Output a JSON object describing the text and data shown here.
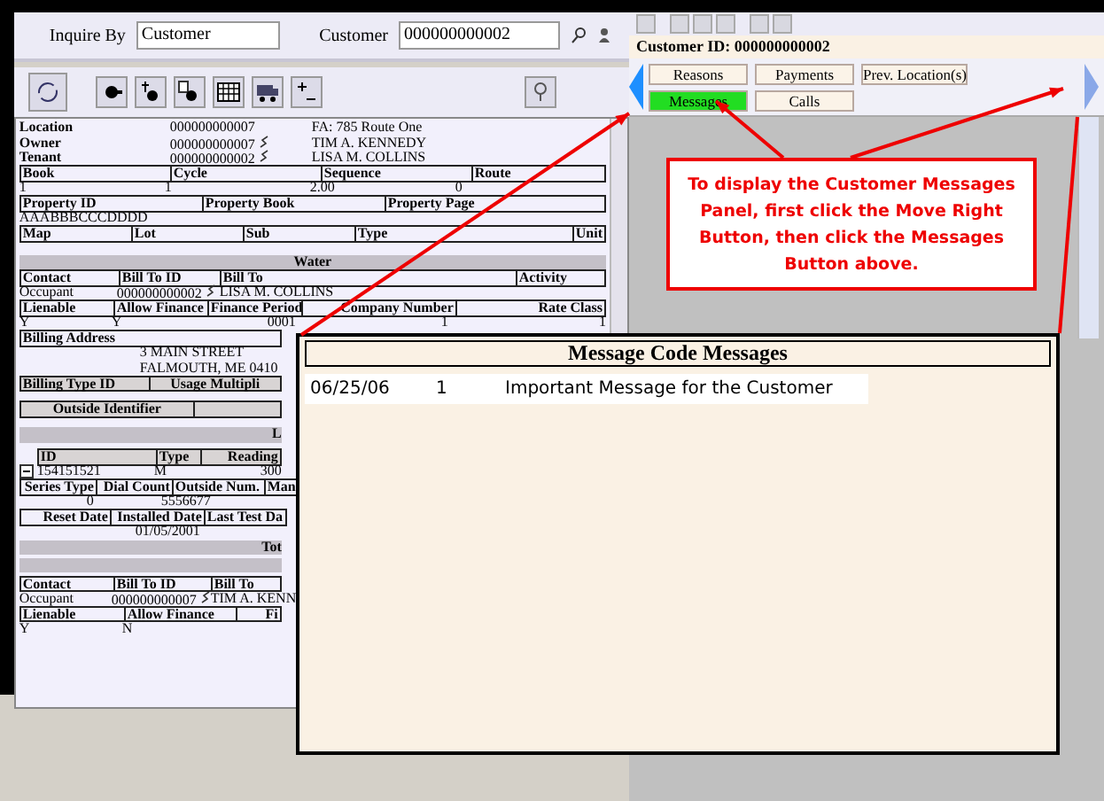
{
  "inquiry": {
    "inquire_by_label": "Inquire By",
    "inquire_by": "Customer",
    "customer_label": "Customer",
    "customer": "000000000002"
  },
  "parties": [
    {
      "label": "Location",
      "id": "000000000007",
      "linked": false,
      "name": "FA: 785 Route One"
    },
    {
      "label": "Owner",
      "id": "000000000007",
      "linked": true,
      "name": "TIM A. KENNEDY"
    },
    {
      "label": "Tenant",
      "id": "000000000002",
      "linked": true,
      "name": "LISA M. COLLINS"
    }
  ],
  "route_grid": {
    "headers": [
      "Book",
      "Cycle",
      "Sequence",
      "Route"
    ],
    "values": [
      "1",
      "1",
      "2.00",
      "0"
    ]
  },
  "property_grid": {
    "headers": [
      "Property ID",
      "Property Book",
      "Property Page"
    ],
    "values": [
      "AAABBBCCCDDDD"
    ]
  },
  "map_grid": {
    "headers": [
      "Map",
      "Lot",
      "Sub",
      "Type",
      "Unit"
    ]
  },
  "water": {
    "title": "Water",
    "contact_headers": [
      "Contact",
      "Bill To ID",
      "Bill To",
      "Activity"
    ],
    "contact_row": {
      "contact": "Occupant",
      "id": "000000000002",
      "linked": true,
      "name": "LISA M. COLLINS"
    },
    "lien_headers": [
      "Lienable",
      "Allow Finance",
      "Finance Period",
      "Company Number",
      "Rate Class"
    ],
    "lien_values": [
      "Y",
      "Y",
      "0001",
      "1",
      "1"
    ],
    "billing_address_label": "Billing Address",
    "address_lines": [
      "3 MAIN STREET",
      "FALMOUTH, ME 0410"
    ],
    "billing_type_label": "Billing Type ID",
    "usage_label": "Usage Multipli",
    "outside_identifier_label": "Outside Identifier",
    "section_heading": "L",
    "meter": {
      "headers": [
        "ID",
        "Type",
        "Reading"
      ],
      "expanded": true,
      "values": [
        "154151521",
        "M",
        "300"
      ]
    },
    "series_headers": [
      "Series Type",
      "Dial Count",
      "Outside Num.",
      "Man"
    ],
    "series_values": [
      "0",
      "5",
      "556677"
    ],
    "date_headers": [
      "Reset Date",
      "Installed Date",
      "Last Test Da"
    ],
    "date_values": [
      "01/05/2001"
    ],
    "total_heading": "Tot"
  },
  "second_contact": {
    "headers": [
      "Contact",
      "Bill To ID",
      "Bill To"
    ],
    "row": {
      "contact": "Occupant",
      "id": "000000000007",
      "linked": true,
      "name": "TIM A. KENN"
    },
    "lien_headers": [
      "Lienable",
      "Allow Finance",
      "Fi"
    ],
    "lien_values": [
      "Y",
      "N"
    ]
  },
  "customer_id": "Customer ID: 000000000002",
  "panel_buttons": [
    {
      "label": "Reasons",
      "selected": false
    },
    {
      "label": "Payments",
      "selected": false
    },
    {
      "label": "Prev. Location(s)",
      "selected": false
    },
    {
      "label": "Messages",
      "selected": true
    },
    {
      "label": "Calls",
      "selected": false
    }
  ],
  "callout": "To display the Customer Messages Panel, first click the Move Right Button, then click the Messages Button above.",
  "messages_popup": {
    "title": "Message Code Messages",
    "rows": [
      {
        "date": "06/25/06",
        "code": "1",
        "text": "Important Message for the Customer"
      }
    ]
  }
}
